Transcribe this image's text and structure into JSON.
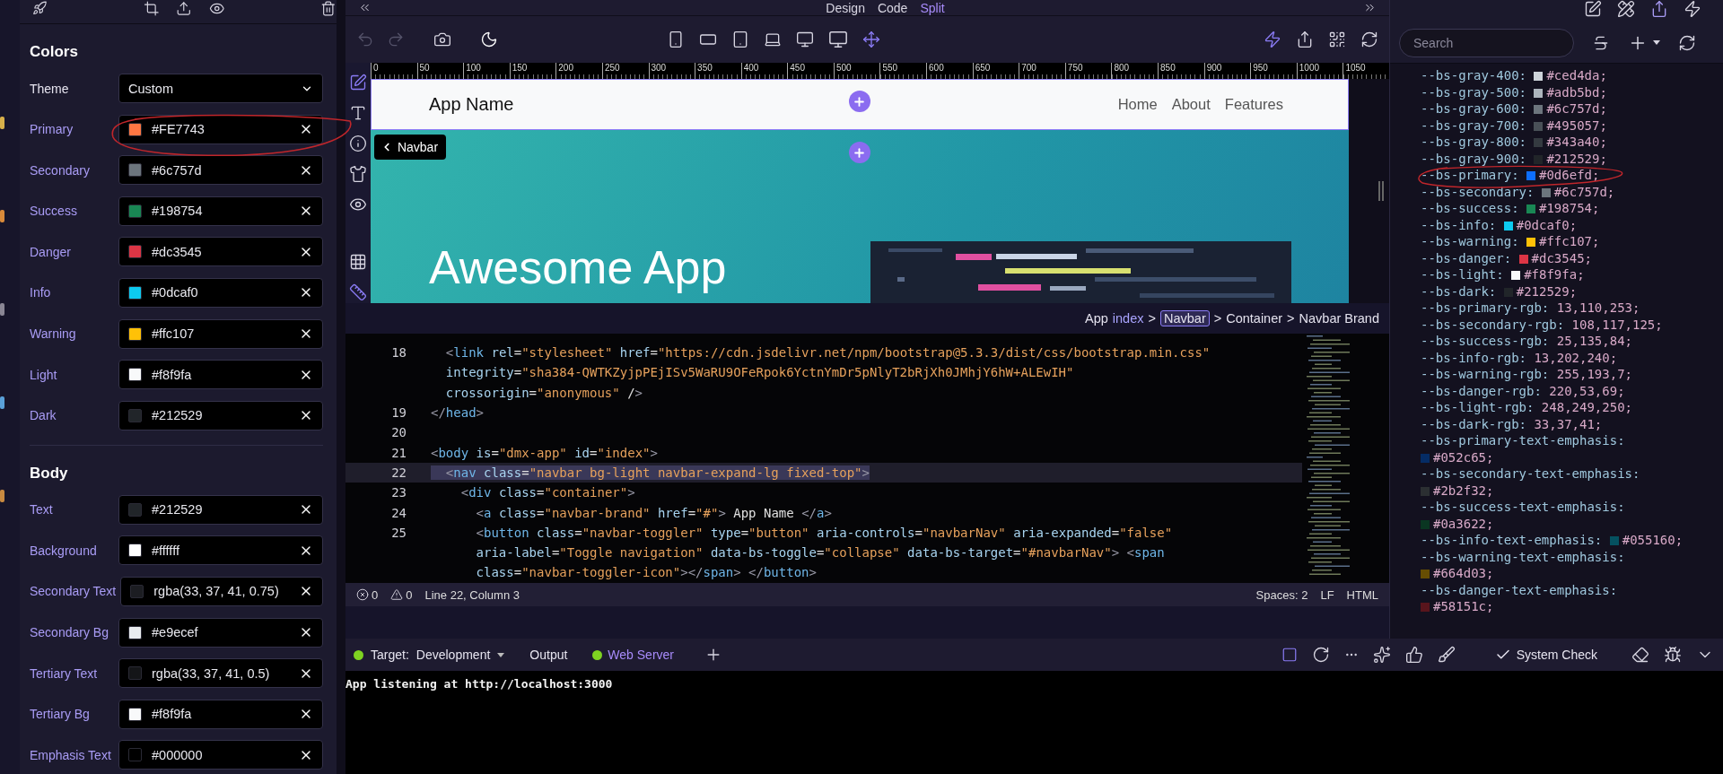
{
  "left_panel": {
    "sections": [
      {
        "title": "Colors",
        "rows": [
          {
            "label": "Theme",
            "kind": "select",
            "value": "Custom"
          },
          {
            "label": "Primary",
            "kind": "color",
            "value": "#FE7743",
            "color": "#fe7743"
          },
          {
            "label": "Secondary",
            "kind": "color",
            "value": "#6c757d",
            "color": "#6c757d"
          },
          {
            "label": "Success",
            "kind": "color",
            "value": "#198754",
            "color": "#198754"
          },
          {
            "label": "Danger",
            "kind": "color",
            "value": "#dc3545",
            "color": "#dc3545"
          },
          {
            "label": "Info",
            "kind": "color",
            "value": "#0dcaf0",
            "color": "#0dcaf0"
          },
          {
            "label": "Warning",
            "kind": "color",
            "value": "#ffc107",
            "color": "#ffc107"
          },
          {
            "label": "Light",
            "kind": "color",
            "value": "#f8f9fa",
            "color": "#f8f9fa"
          },
          {
            "label": "Dark",
            "kind": "color",
            "value": "#212529",
            "color": "#212529"
          }
        ]
      },
      {
        "title": "Body",
        "rows": [
          {
            "label": "Text",
            "kind": "color",
            "value": "#212529",
            "color": "#212529"
          },
          {
            "label": "Background",
            "kind": "color",
            "value": "#ffffff",
            "color": "#ffffff"
          },
          {
            "label": "Secondary Text",
            "kind": "color",
            "value": "rgba(33, 37, 41, 0.75)",
            "color": "#1c1d22"
          },
          {
            "label": "Secondary Bg",
            "kind": "color",
            "value": "#e9ecef",
            "color": "#e9ecef"
          },
          {
            "label": "Tertiary Text",
            "kind": "color",
            "value": "rgba(33, 37, 41, 0.5)",
            "color": "#141518"
          },
          {
            "label": "Tertiary Bg",
            "kind": "color",
            "value": "#f8f9fa",
            "color": "#f8f9fa"
          },
          {
            "label": "Emphasis Text",
            "kind": "color",
            "value": "#000000",
            "color": "#000000"
          }
        ]
      }
    ]
  },
  "mode_tabs": [
    {
      "label": "Design",
      "selected": false
    },
    {
      "label": "Code",
      "selected": false
    },
    {
      "label": "Split",
      "selected": true
    }
  ],
  "ruler": [
    "0",
    "50",
    "100",
    "150",
    "200",
    "250",
    "300",
    "350",
    "400",
    "450",
    "500",
    "550",
    "600",
    "650",
    "700",
    "750",
    "800",
    "850",
    "900",
    "950",
    "1000",
    "1050"
  ],
  "preview": {
    "brand": "App Name",
    "nav_links": [
      "Home",
      "About",
      "Features"
    ],
    "chip": "Navbar",
    "hero_title": "Awesome App"
  },
  "breadcrumb": [
    {
      "label": "App",
      "kind": "app",
      "selected": false
    },
    {
      "label": "index",
      "kind": "page",
      "selected": false
    },
    {
      "label": ">",
      "kind": "sep",
      "selected": false
    },
    {
      "label": "Navbar",
      "kind": "element",
      "selected": true
    },
    {
      "label": ">",
      "kind": "sep",
      "selected": false
    },
    {
      "label": "Container",
      "kind": "element",
      "selected": false
    },
    {
      "label": ">",
      "kind": "sep",
      "selected": false
    },
    {
      "label": "Navbar Brand",
      "kind": "element",
      "selected": false
    }
  ],
  "code": {
    "lines": [
      {
        "number": "18",
        "text": "  <link rel=\"stylesheet\" href=\"https://cdn.jsdelivr.net/npm/bootstrap@5.3.3/dist/css/bootstrap.min.css\"",
        "highlighted": false
      },
      {
        "text": "  integrity=\"sha384-QWTKZyjpPEjISv5WaRU9OFeRpok6YctnYmDr5pNlyT2bRjXh0JMhjY6hW+ALEwIH\"",
        "highlighted": false
      },
      {
        "text": "  crossorigin=\"anonymous\" />",
        "highlighted": false
      },
      {
        "number": "19",
        "text": "</head>",
        "highlighted": false
      },
      {
        "number": "20",
        "highlighted": false
      },
      {
        "number": "21",
        "text": "<body is=\"dmx-app\" id=\"index\">",
        "highlighted": false
      },
      {
        "number": "22",
        "text": "  <nav class=\"navbar bg-light navbar-expand-lg fixed-top\">",
        "highlighted": true
      },
      {
        "number": "23",
        "text": "    <div class=\"container\">",
        "highlighted": false
      },
      {
        "number": "24",
        "text": "      <a class=\"navbar-brand\" href=\"#\"> App Name </a>",
        "highlighted": false
      },
      {
        "number": "25",
        "text": "      <button class=\"navbar-toggler\" type=\"button\" aria-controls=\"navbarNav\" aria-expanded=\"false\"",
        "highlighted": false
      },
      {
        "text": "      aria-label=\"Toggle navigation\" data-bs-toggle=\"collapse\" data-bs-target=\"#navbarNav\"> <span",
        "highlighted": false
      },
      {
        "text": "      class=\"navbar-toggler-icon\"></span> </button>",
        "highlighted": false
      }
    ]
  },
  "status_bar": {
    "errors": "0",
    "warnings": "0",
    "position": "Line 22, Column 3",
    "right": [
      "Spaces: 2",
      "LF",
      "HTML"
    ]
  },
  "css_panel": {
    "search": {
      "placeholder": "Search"
    },
    "variables": [
      {
        "name": "--bs-gray-400:",
        "color": "#ced4da",
        "value": "#ced4da;",
        "wrapped": false
      },
      {
        "name": "--bs-gray-500:",
        "color": "#adb5bd",
        "value": "#adb5bd;",
        "wrapped": false
      },
      {
        "name": "--bs-gray-600:",
        "color": "#6c757d",
        "value": "#6c757d;",
        "wrapped": false
      },
      {
        "name": "--bs-gray-700:",
        "color": "#495057",
        "value": "#495057;",
        "wrapped": false
      },
      {
        "name": "--bs-gray-800:",
        "color": "#343a40",
        "value": "#343a40;",
        "wrapped": false
      },
      {
        "name": "--bs-gray-900:",
        "color": "#212529",
        "value": "#212529;",
        "wrapped": false
      },
      {
        "name": "--bs-primary:",
        "color": "#0d6efd",
        "value": "#0d6efd;",
        "wrapped": false
      },
      {
        "name": "--bs-secondary:",
        "color": "#6c757d",
        "value": "#6c757d;",
        "wrapped": false
      },
      {
        "name": "--bs-success:",
        "color": "#198754",
        "value": "#198754;",
        "wrapped": false
      },
      {
        "name": "--bs-info:",
        "color": "#0dcaf0",
        "value": "#0dcaf0;",
        "wrapped": false
      },
      {
        "name": "--bs-warning:",
        "color": "#ffc107",
        "value": "#ffc107;",
        "wrapped": false
      },
      {
        "name": "--bs-danger:",
        "color": "#dc3545",
        "value": "#dc3545;",
        "wrapped": false
      },
      {
        "name": "--bs-light:",
        "color": "#f8f9fa",
        "value": "#f8f9fa;",
        "wrapped": false
      },
      {
        "name": "--bs-dark:",
        "color": "#212529",
        "value": "#212529;",
        "wrapped": false
      },
      {
        "name": "--bs-primary-rgb:",
        "value": "13,110,253;",
        "wrapped": false
      },
      {
        "name": "--bs-secondary-rgb:",
        "value": "108,117,125;",
        "wrapped": false
      },
      {
        "name": "--bs-success-rgb:",
        "value": "25,135,84;",
        "wrapped": false
      },
      {
        "name": "--bs-info-rgb:",
        "value": "13,202,240;",
        "wrapped": false
      },
      {
        "name": "--bs-warning-rgb:",
        "value": "255,193,7;",
        "wrapped": false
      },
      {
        "name": "--bs-danger-rgb:",
        "value": "220,53,69;",
        "wrapped": false
      },
      {
        "name": "--bs-light-rgb:",
        "value": "248,249,250;",
        "wrapped": false
      },
      {
        "name": "--bs-dark-rgb:",
        "value": "33,37,41;",
        "wrapped": false
      },
      {
        "name": "--bs-primary-text-emphasis:",
        "color": "#052c65",
        "value": "#052c65;",
        "wrapped": true
      },
      {
        "name": "--bs-secondary-text-emphasis:",
        "color": "#2b2f32",
        "value": "#2b2f32;",
        "wrapped": true
      },
      {
        "name": "--bs-success-text-emphasis:",
        "color": "#0a3622",
        "value": "#0a3622;",
        "wrapped": true
      },
      {
        "name": "--bs-info-text-emphasis:",
        "color": "#055160",
        "value": "#055160;",
        "wrapped": false
      },
      {
        "name": "--bs-warning-text-emphasis:",
        "color": "#664d03",
        "value": "#664d03;",
        "wrapped": true
      },
      {
        "name": "--bs-danger-text-emphasis:",
        "color": "#58151c",
        "value": "#58151c;",
        "wrapped": true
      }
    ]
  },
  "terminal": {
    "target_label": "Target:",
    "target": "Development",
    "tabs": [
      {
        "label": "Output",
        "selected": false
      },
      {
        "label": "Web Server",
        "selected": true
      }
    ],
    "system_check": "System Check",
    "output": "App listening at http://localhost:3000"
  }
}
